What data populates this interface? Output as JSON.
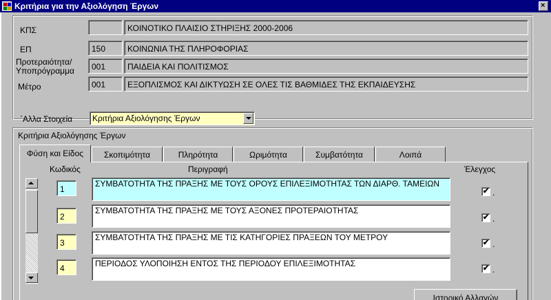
{
  "window": {
    "title": "Κριτήρια για την Αξιολόγηση Έργων"
  },
  "header": {
    "kps": {
      "label": "ΚΠΣ",
      "code": "",
      "description": "ΚΟΙΝΟΤΙΚΟ ΠΛΑΙΣΙΟ ΣΤΗΡΙΞΗΣ 2000-2006"
    },
    "ep": {
      "label": "ΕΠ",
      "code": "150",
      "description": "ΚΟΙΝΩΝΙΑ ΤΗΣ ΠΛΗΡΟΦΟΡΙΑΣ"
    },
    "priority": {
      "label_line1": "Προτεραιότητα/",
      "label_line2": "Υποπρόγραμμα",
      "code": "001",
      "description": "ΠΑΙΔΕΙΑ ΚΑΙ ΠΟΛΙΤΙΣΜΟΣ"
    },
    "measure": {
      "label": "Μέτρο",
      "code": "001",
      "description": "ΕΞΟΠΛΙΣΜΟΣ ΚΑΙ ΔΙΚΤΥΩΣΗ ΣΕ ΟΛΕΣ ΤΙΣ ΒΑΘΜΙΔΕΣ ΤΗΣ ΕΚΠΑΙΔΕΥΣΗΣ"
    }
  },
  "other": {
    "label": "΄Αλλα Στοιχεία",
    "selected": "Κριτήρια Αξιολόγησης Έργων"
  },
  "criteria_group": {
    "title": "Κριτήρια Αξιολόγησης Έργων"
  },
  "tabs": [
    {
      "label": "Φύση και Είδος"
    },
    {
      "label": "Σκοπιμότητα"
    },
    {
      "label": "Πληρότητα"
    },
    {
      "label": "Ωριμότητα"
    },
    {
      "label": "Συμβατότητα"
    },
    {
      "label": "Λοιπά"
    }
  ],
  "table": {
    "col_code": "Κωδικός",
    "col_desc": "Περιγραφή",
    "col_check": "Έλεγχος",
    "rows": [
      {
        "code": "1",
        "description": "ΣΥΜΒΑΤΟΤΗΤΑ ΤΗΣ ΠΡΑΞΗΣ ΜΕ ΤΟΥΣ ΟΡΟΥΣ ΕΠΙΛΕΞΙΜΟΤΗΤΑΣ ΤΩΝ ΔΙΑΡΘ. ΤΑΜΕΙΩΝ",
        "check": "✔",
        "dot": "."
      },
      {
        "code": "2",
        "description": "ΣΥΜΒΑΤΟΤΗΤΑ ΤΗΣ ΠΡΑΞΗΣ ΜΕ ΤΟΥΣ ΑΞΟΝΕΣ ΠΡΟΤΕΡΑΙΟΤΗΤΑΣ",
        "check": "✔",
        "dot": "."
      },
      {
        "code": "3",
        "description": "ΣΥΜΒΑΤΟΤΗΤΑ ΤΗΣ ΠΡΑΞΗΣ ΜΕ ΤΙΣ ΚΑΤΗΓΟΡΙΕΣ ΠΡΑΞΕΩΝ ΤΟΥ ΜΕΤΡΟΥ",
        "check": "✔",
        "dot": "."
      },
      {
        "code": "4",
        "description": "ΠΕΡΙΟΔΟΣ ΥΛΟΠΟΙΗΣΗ ΕΝΤΟΣ ΤΗΣ ΠΕΡΙΟΔΟΥ ΕΠΙΛΕΞΙΜΟΤΗΤΑΣ",
        "check": "✔",
        "dot": "."
      }
    ]
  },
  "history_button": {
    "label": "Ιστορικό Αλλαγών"
  },
  "icons": {
    "app": "app-window-icon",
    "close": "close-icon",
    "scroll_up": "arrow-up-icon",
    "scroll_down": "arrow-down-icon",
    "combo": "chevron-down-icon"
  },
  "colors": {
    "titlebar": "#000080",
    "selected_row": "#c0ffff",
    "field_yellow": "#ffffc0",
    "face": "#c0c0c0"
  }
}
